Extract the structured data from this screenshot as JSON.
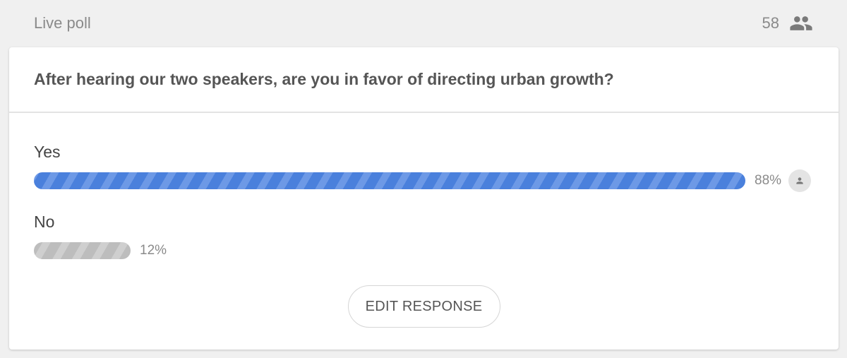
{
  "header": {
    "title": "Live poll",
    "participant_count": "58",
    "participants_icon": "people-icon"
  },
  "poll": {
    "question": "After hearing our two speakers, are you in favor of directing urban growth?",
    "options": [
      {
        "label": "Yes",
        "percent_label": "88%",
        "percent": 88,
        "selected": true,
        "color": "#4a80dc"
      },
      {
        "label": "No",
        "percent_label": "12%",
        "percent": 12,
        "selected": false,
        "color": "#bdbdbd"
      }
    ],
    "edit_button_label": "EDIT RESPONSE"
  }
}
